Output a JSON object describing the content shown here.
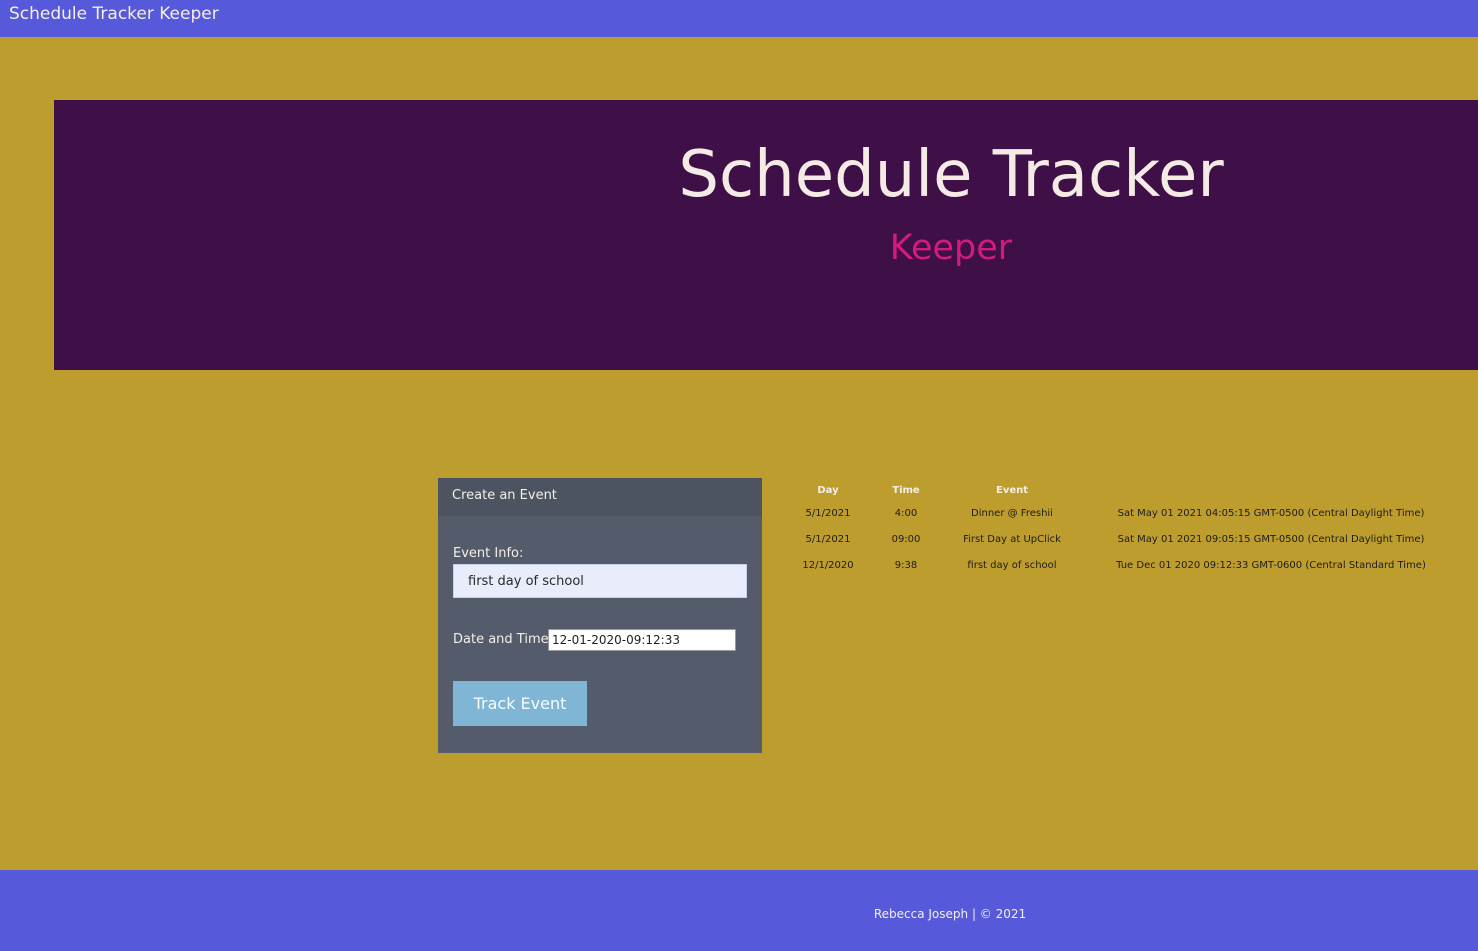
{
  "navbar": {
    "brand": "Schedule Tracker Keeper"
  },
  "hero": {
    "title": "Schedule Tracker",
    "subtitle": "Keeper"
  },
  "form": {
    "header": "Create an Event",
    "event_info_label": "Event Info:",
    "event_info_value": "first day of school",
    "datetime_label": "Date and Time:",
    "datetime_value": "12-01-2020-09:12:33",
    "submit_label": "Track Event"
  },
  "events_table": {
    "headers": [
      "Day",
      "Time",
      "Event",
      ""
    ],
    "rows": [
      {
        "day": "5/1/2021",
        "time": "4:00",
        "event": "Dinner @ Freshii",
        "full": "Sat May 01 2021 04:05:15 GMT-0500 (Central Daylight Time)"
      },
      {
        "day": "5/1/2021",
        "time": "09:00",
        "event": "First Day at UpClick",
        "full": "Sat May 01 2021 09:05:15 GMT-0500 (Central Daylight Time)"
      },
      {
        "day": "12/1/2020",
        "time": "9:38",
        "event": "first day of school",
        "full": "Tue Dec 01 2020 09:12:33 GMT-0600 (Central Standard Time)"
      }
    ]
  },
  "footer": {
    "text": "Rebecca Joseph | © 2021"
  },
  "colors": {
    "page_background": "#be9d2f",
    "navbar": "#5659d9",
    "hero_background": "#3f0f48",
    "hero_title": "#f4ebe5",
    "hero_subtitle": "#d21b7c",
    "card": "#545b6a",
    "button": "#7fb6d5"
  }
}
